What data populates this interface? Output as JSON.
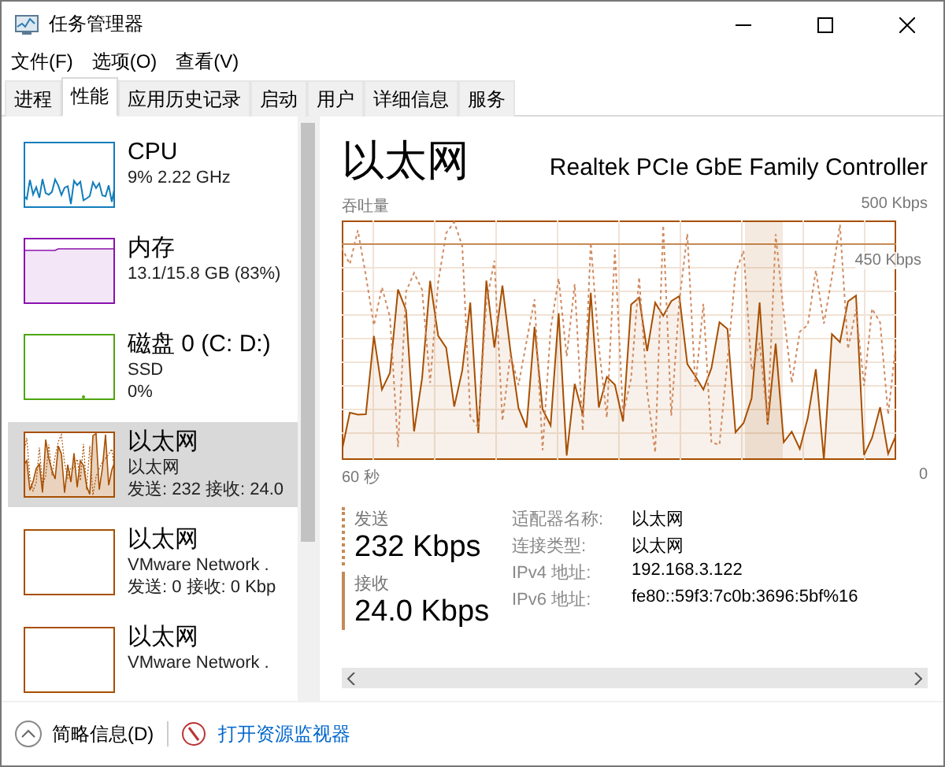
{
  "window": {
    "title": "任务管理器"
  },
  "menu": [
    "文件(F)",
    "选项(O)",
    "查看(V)"
  ],
  "tabs": [
    {
      "label": "进程",
      "selected": false
    },
    {
      "label": "性能",
      "selected": true
    },
    {
      "label": "应用历史记录",
      "selected": false
    },
    {
      "label": "启动",
      "selected": false
    },
    {
      "label": "用户",
      "selected": false
    },
    {
      "label": "详细信息",
      "selected": false
    },
    {
      "label": "服务",
      "selected": false
    }
  ],
  "sidebar": {
    "items": [
      {
        "kind": "cpu",
        "title": "CPU",
        "lines": [
          "9% 2.22 GHz"
        ],
        "color": "#117dbb",
        "selected": false
      },
      {
        "kind": "memory",
        "title": "内存",
        "lines": [
          "13.1/15.8 GB (83%)"
        ],
        "color": "#8b12ae",
        "selected": false
      },
      {
        "kind": "disk",
        "title": "磁盘 0 (C: D:)",
        "lines": [
          "SSD",
          "0%"
        ],
        "color": "#4da60c",
        "selected": false
      },
      {
        "kind": "network",
        "title": "以太网",
        "lines": [
          "以太网",
          "发送: 232 接收: 24.0"
        ],
        "color": "#a74f01",
        "selected": true
      },
      {
        "kind": "idle",
        "title": "以太网",
        "lines": [
          "VMware Network .",
          "发送: 0 接收: 0 Kbp"
        ],
        "color": "#a74f01",
        "selected": false
      },
      {
        "kind": "idle",
        "title": "以太网",
        "lines": [
          "VMware Network ."
        ],
        "color": "#a74f01",
        "selected": false
      }
    ]
  },
  "detail": {
    "title": "以太网",
    "adapter": "Realtek PCIe GbE Family Controller",
    "graph_label": "吞吐量",
    "graph_max": "500 Kbps",
    "graph_marker": "450 Kbps",
    "graph_start": "60 秒",
    "graph_end": "0",
    "send": {
      "label": "发送",
      "value": "232 Kbps"
    },
    "receive": {
      "label": "接收",
      "value": "24.0 Kbps"
    },
    "info": [
      {
        "label": "适配器名称:",
        "value": "以太网"
      },
      {
        "label": "连接类型:",
        "value": "以太网"
      },
      {
        "label": "IPv4 地址:",
        "value": "192.168.3.122"
      },
      {
        "label": "IPv6 地址:",
        "value": "fe80::59f3:7c0b:3696:5bf%16"
      }
    ]
  },
  "footer": {
    "summary": "简略信息(D)",
    "link": "打开资源监视器"
  }
}
